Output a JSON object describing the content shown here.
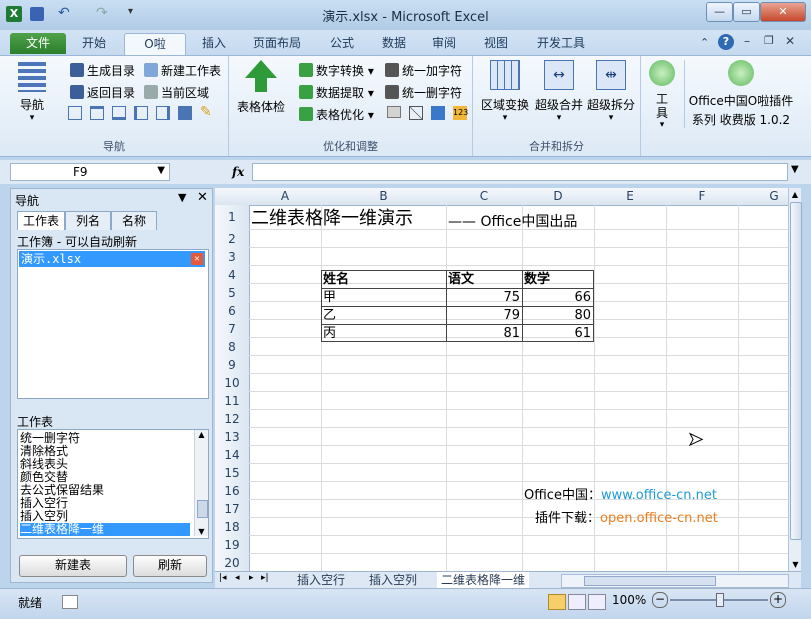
{
  "window": {
    "title": "演示.xlsx - Microsoft Excel"
  },
  "tabs": [
    "文件",
    "开始",
    "O啦",
    "插入",
    "页面布局",
    "公式",
    "数据",
    "审阅",
    "视图",
    "开发工具"
  ],
  "ribbon": {
    "nav_group": {
      "big_button": "导航",
      "buttons": [
        "生成目录",
        "返回目录",
        "新建工作表",
        "当前区域"
      ],
      "label": "导航"
    },
    "optimize_group": {
      "big_button": "表格体检",
      "buttons": [
        "数字转换",
        "数据提取",
        "表格优化",
        "统一加字符",
        "统一删字符"
      ],
      "label": "优化和调整"
    },
    "merge_group": {
      "buttons": [
        "区域变换",
        "超级合并",
        "超级拆分"
      ],
      "label": "合并和拆分"
    },
    "tools_button": "工具",
    "plugin": {
      "line1": "Office中国O啦插件",
      "line2": "系列 收费版 1.0.2"
    }
  },
  "formula_bar": {
    "name_box": "F9",
    "fx": "fx",
    "formula": ""
  },
  "nav_pane": {
    "title": "导航",
    "tabs": [
      "工作表",
      "列名",
      "名称"
    ],
    "workbook_label": "工作簿 - 可以自动刷新",
    "workbooks": [
      "演示.xlsx"
    ],
    "sheets_label": "工作表",
    "sheets": [
      "统一删字符",
      "清除格式",
      "斜线表头",
      "颜色交替",
      "去公式保留结果",
      "插入空行",
      "插入空列",
      "二维表格降一维"
    ],
    "selected_sheet": "二维表格降一维",
    "new_button": "新建表",
    "refresh_button": "刷新"
  },
  "sheet": {
    "columns": [
      "A",
      "B",
      "C",
      "D",
      "E",
      "F",
      "G"
    ],
    "rows": [
      "1",
      "2",
      "3",
      "4",
      "5",
      "6",
      "7",
      "8",
      "9",
      "10",
      "11",
      "12",
      "13",
      "14",
      "15",
      "16",
      "17",
      "18",
      "19",
      "20"
    ],
    "title": "二维表格降一维演示",
    "subtitle": "—— Office中国出品",
    "headers": [
      "姓名",
      "语文",
      "数学"
    ],
    "data": [
      [
        "甲",
        "75",
        "66"
      ],
      [
        "乙",
        "79",
        "80"
      ],
      [
        "丙",
        "81",
        "61"
      ]
    ],
    "footer1_label": "Office中国：",
    "footer1_link": "www.office-cn.net",
    "footer2_label": "插件下载：",
    "footer2_link": "open.office-cn.net"
  },
  "sheet_tabs": [
    "插入空行",
    "插入空列",
    "二维表格降一维"
  ],
  "status": {
    "ready": "就绪",
    "zoom": "100%"
  },
  "colors": {
    "link_blue": "#1f9bd6",
    "link_orange": "#ee7d1a",
    "file_tab": "#2f8a2e",
    "selection": "#3399ff"
  }
}
